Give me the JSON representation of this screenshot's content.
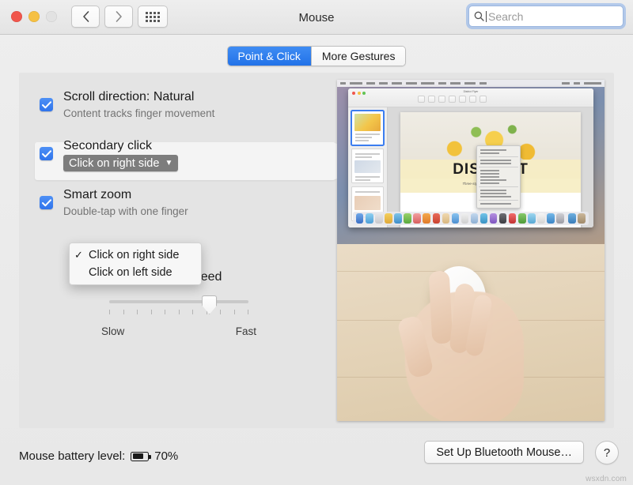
{
  "window": {
    "title": "Mouse",
    "traffic_lights": [
      "close",
      "minimize",
      "zoom-disabled"
    ],
    "nav": {
      "back": "back-arrow",
      "forward": "forward-arrow",
      "grid": "show-all-grid"
    },
    "search": {
      "placeholder": "Search",
      "value": "",
      "icon": "search-icon",
      "focused": true
    }
  },
  "tabs": [
    {
      "label": "Point & Click",
      "active": true
    },
    {
      "label": "More Gestures",
      "active": false
    }
  ],
  "options": [
    {
      "checked": true,
      "title": "Scroll direction: Natural",
      "subtitle": "Content tracks finger movement"
    },
    {
      "checked": true,
      "title": "Secondary click",
      "subtitle": "",
      "popup": {
        "value": "Click on right side",
        "chevron": "chevron-down-icon"
      }
    },
    {
      "checked": true,
      "title": "Smart zoom",
      "subtitle": "Double-tap with one finger"
    }
  ],
  "dropdown_menu": {
    "open": true,
    "items": [
      {
        "label": "Click on right side",
        "checked": true
      },
      {
        "label": "Click on left side",
        "checked": false
      }
    ]
  },
  "tracking": {
    "label": "Tracking speed",
    "min_label": "Slow",
    "max_label": "Fast",
    "ticks": 11,
    "value_percent": 72
  },
  "preview": {
    "top_scene": {
      "app": "Pages",
      "document_title": "DISTRICT",
      "document_subtitle": "Three-style products for your kitchen",
      "context_menu_open": true
    },
    "bottom_scene": "hand-on-magic-mouse"
  },
  "footer": {
    "battery_label": "Mouse battery level:",
    "battery_percent": "70%",
    "battery_icon": "battery-icon",
    "setup_button": "Set Up Bluetooth Mouse…",
    "help_button": "?"
  },
  "watermark": "wsxdn.com",
  "colors": {
    "accent_blue": "#2f74ec",
    "tab_active": "#3f8cf3",
    "checkbox": "#3b7ff0",
    "popup_gray": "#7d7d7d",
    "panel_bg": "#e4e4e4"
  }
}
